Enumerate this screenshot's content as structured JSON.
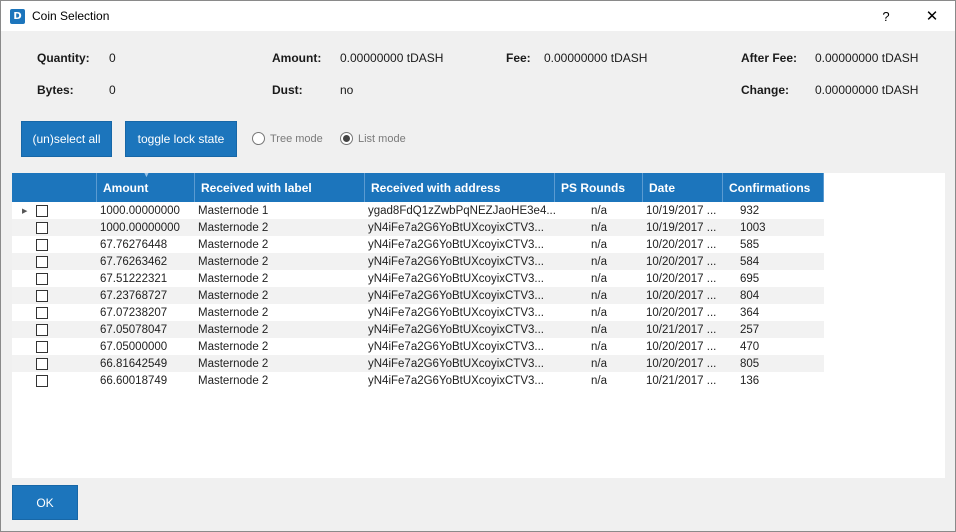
{
  "window": {
    "title": "Coin Selection",
    "icon_char": "D",
    "help": "?",
    "close": "✕"
  },
  "summary": {
    "quantity_label": "Quantity:",
    "quantity_value": "0",
    "bytes_label": "Bytes:",
    "bytes_value": "0",
    "amount_label": "Amount:",
    "amount_value": "0.00000000 tDASH",
    "dust_label": "Dust:",
    "dust_value": "no",
    "fee_label": "Fee:",
    "fee_value": "0.00000000 tDASH",
    "after_fee_label": "After Fee:",
    "after_fee_value": "0.00000000 tDASH",
    "change_label": "Change:",
    "change_value": "0.00000000 tDASH"
  },
  "controls": {
    "select_all_label": "(un)select all",
    "toggle_lock_label": "toggle lock state",
    "tree_mode_label": "Tree mode",
    "list_mode_label": "List mode",
    "selected_mode": "list"
  },
  "table": {
    "headers": [
      "",
      "Amount",
      "Received with label",
      "Received with address",
      "PS Rounds",
      "Date",
      "Confirmations"
    ],
    "rows": [
      {
        "amount": "1000.00000000",
        "label": "Masternode 1",
        "address": "ygad8FdQ1zZwbPqNEZJaoHE3e4...",
        "ps": "n/a",
        "date": "10/19/2017 ...",
        "conf": "932",
        "expandable": true
      },
      {
        "amount": "1000.00000000",
        "label": "Masternode 2",
        "address": "yN4iFe7a2G6YoBtUXcoyixCTV3...",
        "ps": "n/a",
        "date": "10/19/2017 ...",
        "conf": "1003"
      },
      {
        "amount": "67.76276448",
        "label": "Masternode 2",
        "address": "yN4iFe7a2G6YoBtUXcoyixCTV3...",
        "ps": "n/a",
        "date": "10/20/2017 ...",
        "conf": "585"
      },
      {
        "amount": "67.76263462",
        "label": "Masternode 2",
        "address": "yN4iFe7a2G6YoBtUXcoyixCTV3...",
        "ps": "n/a",
        "date": "10/20/2017 ...",
        "conf": "584"
      },
      {
        "amount": "67.51222321",
        "label": "Masternode 2",
        "address": "yN4iFe7a2G6YoBtUXcoyixCTV3...",
        "ps": "n/a",
        "date": "10/20/2017 ...",
        "conf": "695"
      },
      {
        "amount": "67.23768727",
        "label": "Masternode 2",
        "address": "yN4iFe7a2G6YoBtUXcoyixCTV3...",
        "ps": "n/a",
        "date": "10/20/2017 ...",
        "conf": "804"
      },
      {
        "amount": "67.07238207",
        "label": "Masternode 2",
        "address": "yN4iFe7a2G6YoBtUXcoyixCTV3...",
        "ps": "n/a",
        "date": "10/20/2017 ...",
        "conf": "364"
      },
      {
        "amount": "67.05078047",
        "label": "Masternode 2",
        "address": "yN4iFe7a2G6YoBtUXcoyixCTV3...",
        "ps": "n/a",
        "date": "10/21/2017 ...",
        "conf": "257"
      },
      {
        "amount": "67.05000000",
        "label": "Masternode 2",
        "address": "yN4iFe7a2G6YoBtUXcoyixCTV3...",
        "ps": "n/a",
        "date": "10/20/2017 ...",
        "conf": "470"
      },
      {
        "amount": "66.81642549",
        "label": "Masternode 2",
        "address": "yN4iFe7a2G6YoBtUXcoyixCTV3...",
        "ps": "n/a",
        "date": "10/20/2017 ...",
        "conf": "805"
      },
      {
        "amount": "66.60018749",
        "label": "Masternode 2",
        "address": "yN4iFe7a2G6YoBtUXcoyixCTV3...",
        "ps": "n/a",
        "date": "10/21/2017 ...",
        "conf": "136"
      }
    ]
  },
  "footer": {
    "ok_label": "OK"
  },
  "colors": {
    "accent": "#1c75bc",
    "header_text": "#ffffff",
    "alt_row": "#f2f2f2"
  }
}
